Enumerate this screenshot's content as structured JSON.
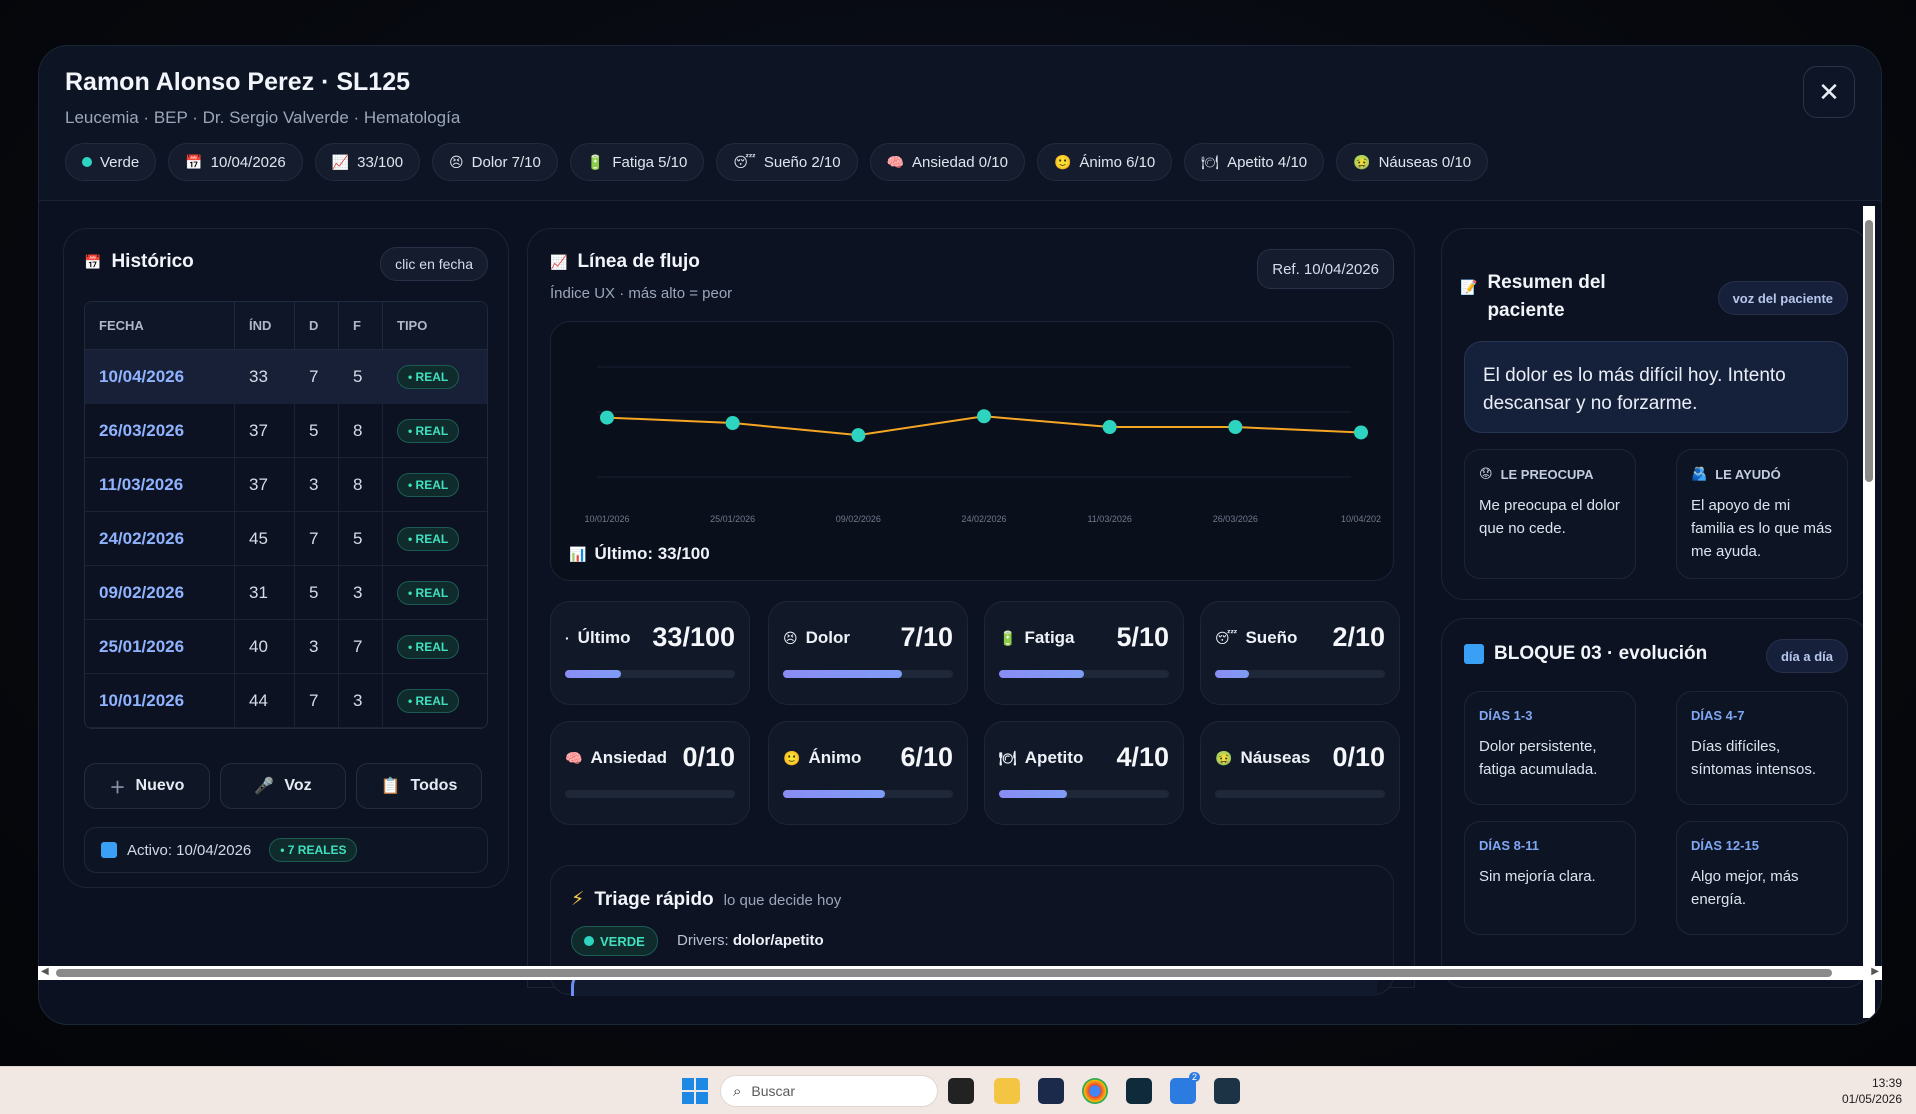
{
  "patient": {
    "name": "Ramon Alonso Perez · SL125",
    "subtitle": "Leucemia · BEP · Dr. Sergio Valverde · Hematología"
  },
  "chips": [
    {
      "icon": "green-dot",
      "label": "Verde"
    },
    {
      "icon": "calendar-icon",
      "label": "10/04/2026"
    },
    {
      "icon": "chart-up-icon",
      "label": "33/100"
    },
    {
      "icon": "pain-face-icon",
      "label": "Dolor 7/10"
    },
    {
      "icon": "fatigue-icon",
      "label": "Fatiga 5/10"
    },
    {
      "icon": "sleep-face-icon",
      "label": "Sueño 2/10"
    },
    {
      "icon": "brain-icon",
      "label": "Ansiedad 0/10"
    },
    {
      "icon": "smile-face-icon",
      "label": "Ánimo 6/10"
    },
    {
      "icon": "plate-icon",
      "label": "Apetito 4/10"
    },
    {
      "icon": "nausea-face-icon",
      "label": "Náuseas 0/10"
    }
  ],
  "historico": {
    "title": "Histórico",
    "hint": "clic en fecha",
    "columns": [
      "FECHA",
      "ÍND",
      "D",
      "F",
      "TIPO"
    ],
    "rows": [
      {
        "fecha": "10/04/2026",
        "ind": "33",
        "d": "7",
        "f": "5",
        "tipo": "• REAL"
      },
      {
        "fecha": "26/03/2026",
        "ind": "37",
        "d": "5",
        "f": "8",
        "tipo": "• REAL"
      },
      {
        "fecha": "11/03/2026",
        "ind": "37",
        "d": "3",
        "f": "8",
        "tipo": "• REAL"
      },
      {
        "fecha": "24/02/2026",
        "ind": "45",
        "d": "7",
        "f": "5",
        "tipo": "• REAL"
      },
      {
        "fecha": "09/02/2026",
        "ind": "31",
        "d": "5",
        "f": "3",
        "tipo": "• REAL"
      },
      {
        "fecha": "25/01/2026",
        "ind": "40",
        "d": "3",
        "f": "7",
        "tipo": "• REAL"
      },
      {
        "fecha": "10/01/2026",
        "ind": "44",
        "d": "7",
        "f": "3",
        "tipo": "• REAL"
      }
    ],
    "buttons": {
      "nuevo": "Nuevo",
      "voz": "Voz",
      "todos": "Todos"
    },
    "active_label": "Activo: 10/04/2026",
    "reales_badge": "• 7 REALES"
  },
  "flujo": {
    "title": "Línea de flujo",
    "subtitle": "Índice UX · más alto = peor",
    "ref": "Ref. 10/04/2026",
    "last": "Último: 33/100"
  },
  "chart_data": {
    "type": "line",
    "x": [
      "10/01/2026",
      "25/01/2026",
      "09/02/2026",
      "24/02/2026",
      "11/03/2026",
      "26/03/2026",
      "10/04/202"
    ],
    "series": [
      {
        "values": [
          44,
          40,
          31,
          45,
          37,
          37,
          33
        ]
      }
    ],
    "ylim": [
      0,
      100
    ],
    "line_color": "#f5a623",
    "marker_color": "#2dd4bf"
  },
  "metrics": [
    {
      "icon": "dot-icon",
      "name": "Último",
      "value": "33/100",
      "fill": 0.33
    },
    {
      "icon": "pain-face-icon",
      "name": "Dolor",
      "value": "7/10",
      "fill": 0.7
    },
    {
      "icon": "fatigue-icon",
      "name": "Fatiga",
      "value": "5/10",
      "fill": 0.5
    },
    {
      "icon": "sleep-face-icon",
      "name": "Sueño",
      "value": "2/10",
      "fill": 0.2
    },
    {
      "icon": "brain-icon",
      "name": "Ansiedad",
      "value": "0/10",
      "fill": 0
    },
    {
      "icon": "smile-face-icon",
      "name": "Ánimo",
      "value": "6/10",
      "fill": 0.6
    },
    {
      "icon": "plate-icon",
      "name": "Apetito",
      "value": "4/10",
      "fill": 0.4
    },
    {
      "icon": "nausea-face-icon",
      "name": "Náuseas",
      "value": "0/10",
      "fill": 0
    }
  ],
  "triage": {
    "title": "Triage rápido",
    "subtitle": "lo que decide hoy",
    "badge": "VERDE",
    "drivers_label": "Drivers:",
    "drivers_value": "dolor/apetito"
  },
  "resumen": {
    "title_line1": "Resumen del",
    "title_line2": "paciente",
    "tag": "voz del paciente",
    "quote": "El dolor es lo más difícil hoy. Intento descansar y no forzarme.",
    "preocupa_label": "LE PREOCUPA",
    "preocupa_text": "Me preocupa el dolor que no cede.",
    "ayudo_label": "LE AYUDÓ",
    "ayudo_text": "El apoyo de mi familia es lo que más me ayuda."
  },
  "bloque": {
    "title": "BLOQUE 03 · evolución",
    "tag": "día a día",
    "cards": [
      {
        "label": "DÍAS 1-3",
        "text": "Dolor persistente, fatiga acumulada."
      },
      {
        "label": "DÍAS 4-7",
        "text": "Días difíciles, síntomas intensos."
      },
      {
        "label": "DÍAS 8-11",
        "text": "Sin mejoría clara."
      },
      {
        "label": "DÍAS 12-15",
        "text": "Algo mejor, más energía."
      }
    ]
  },
  "taskbar": {
    "search_placeholder": "Buscar",
    "time": "13:39",
    "date": "01/05/2026",
    "badge_count": "2"
  },
  "colors": {
    "accent_green": "#3fe0bf",
    "accent_blue": "#8fb3ff",
    "bar_fill": "#8a8cf3",
    "background": "#0b1120"
  }
}
